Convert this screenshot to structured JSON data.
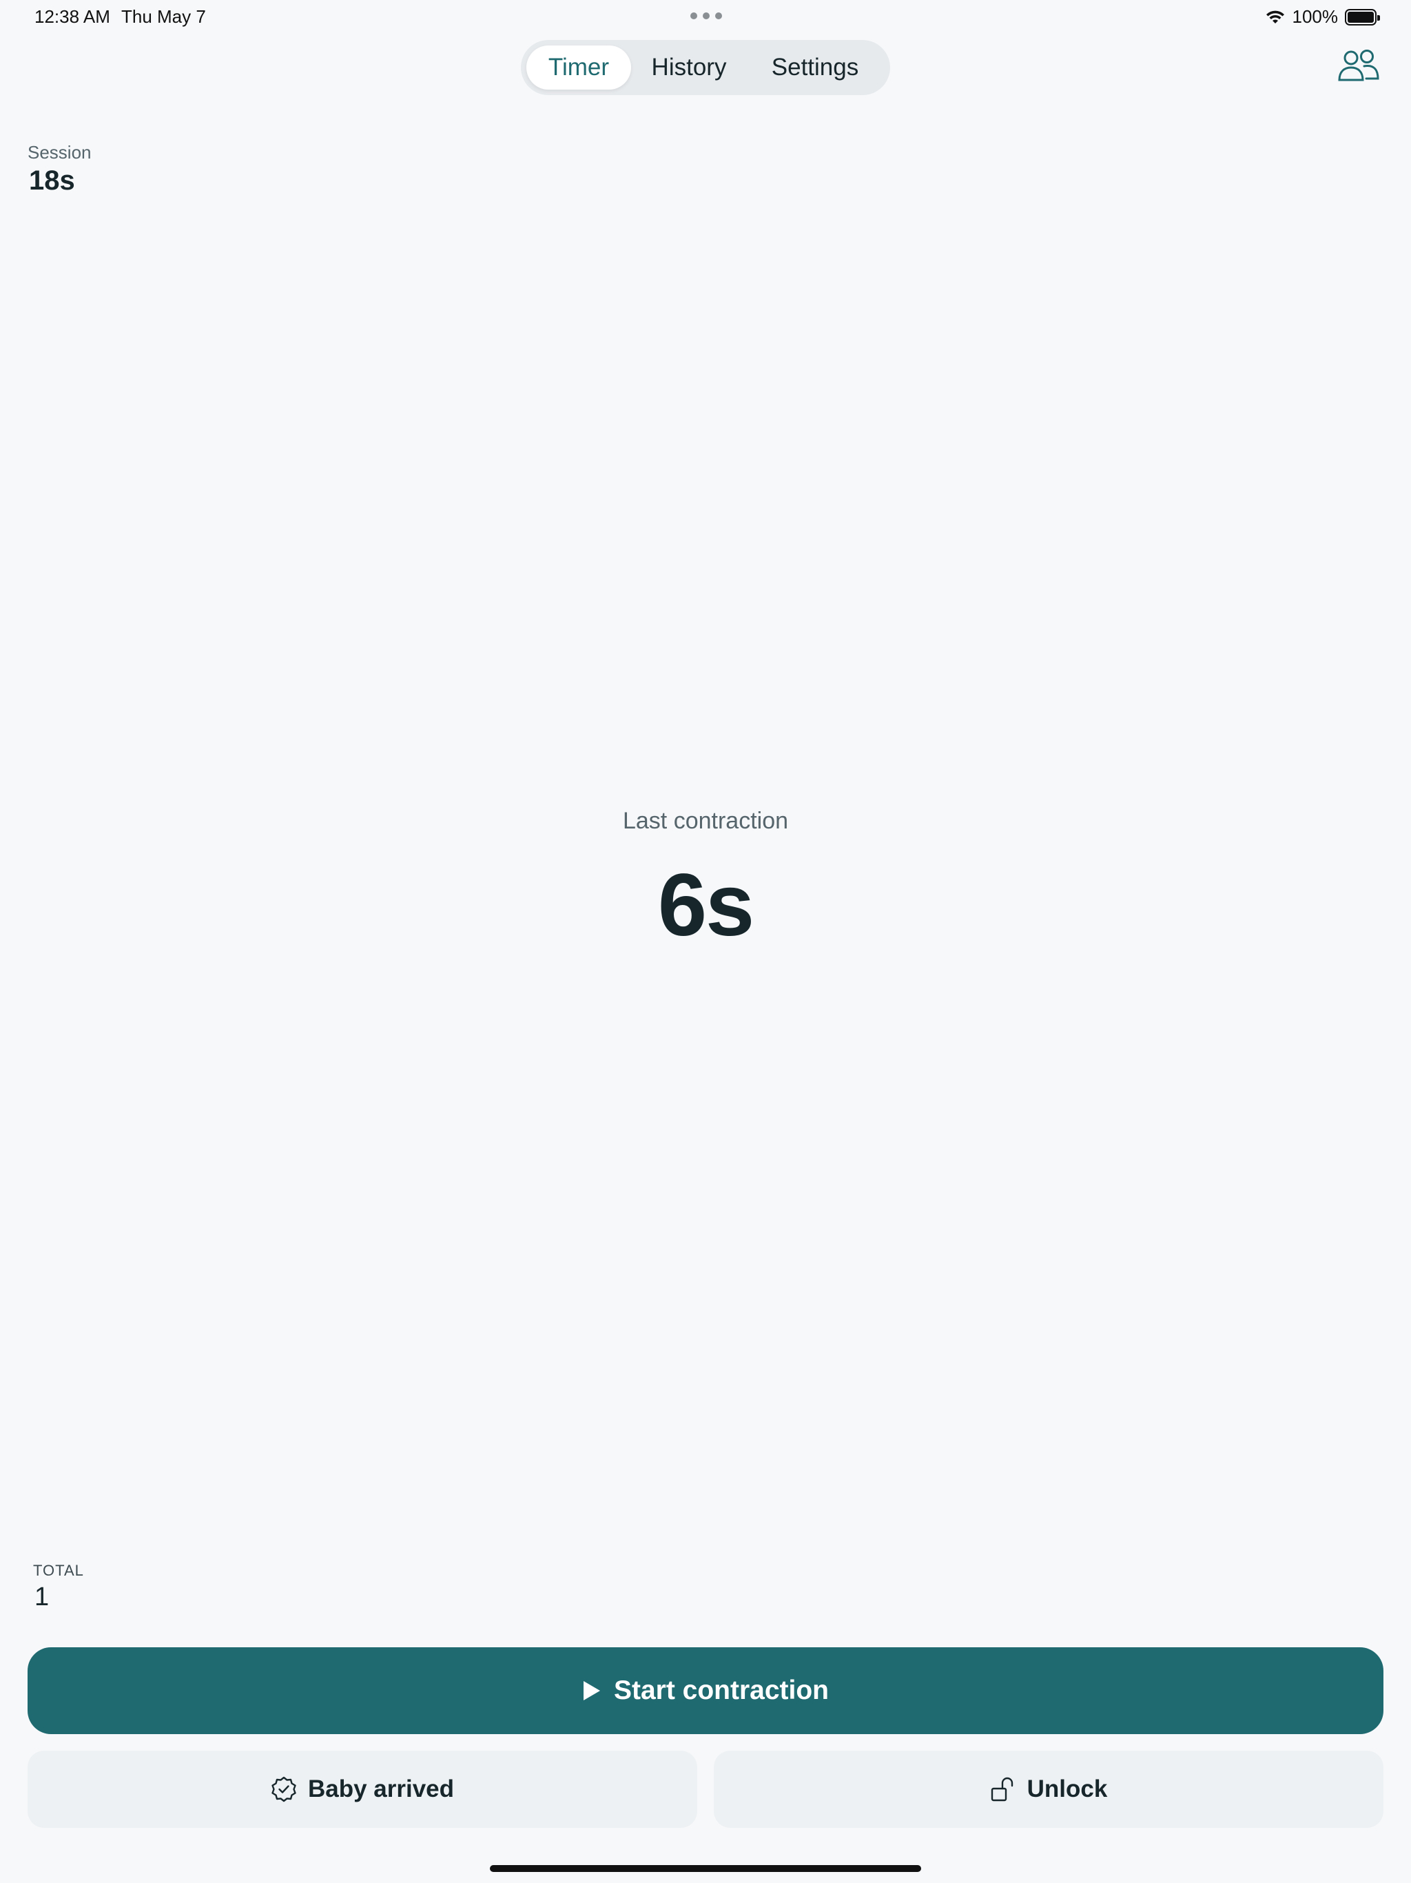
{
  "status_bar": {
    "time": "12:38 AM",
    "date": "Thu May 7",
    "battery": "100%"
  },
  "tabs": [
    {
      "label": "Timer",
      "active": true
    },
    {
      "label": "History",
      "active": false
    },
    {
      "label": "Settings",
      "active": false
    }
  ],
  "header": {
    "people_icon": "people-icon"
  },
  "session": {
    "label": "Session",
    "value": "18s"
  },
  "last_contraction": {
    "label": "Last contraction",
    "value": "6s"
  },
  "total": {
    "label": "TOTAL",
    "value": "1"
  },
  "actions": {
    "start_label": "Start contraction",
    "baby_label": "Baby arrived",
    "unlock_label": "Unlock"
  },
  "colors": {
    "accent": "#1f6a70",
    "background": "#f6f8fa",
    "secondary_button": "#eef1f3"
  }
}
